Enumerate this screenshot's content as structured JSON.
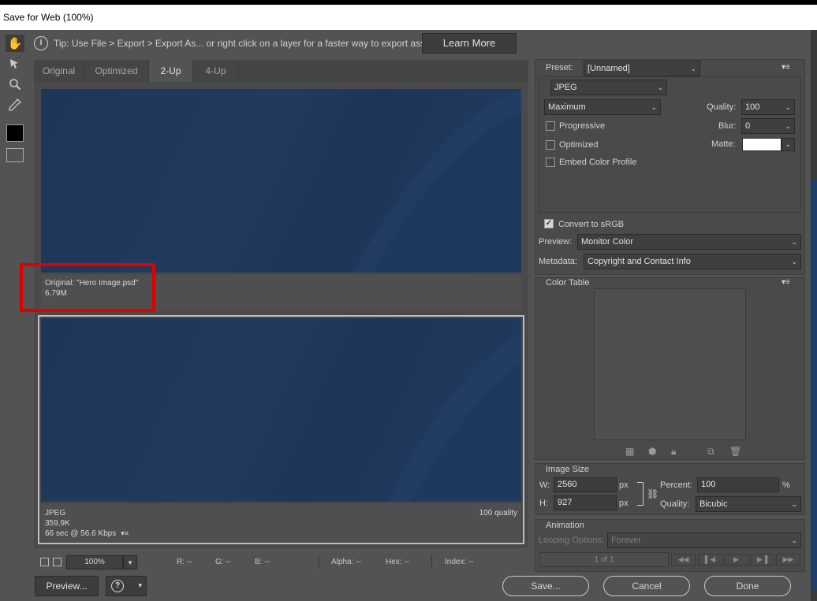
{
  "window": {
    "title": "Save for Web (100%)"
  },
  "tip": {
    "text": "Tip: Use File > Export > Export As...  or right click on a layer for a faster way to export assets",
    "learn_more": "Learn More"
  },
  "tabs": [
    {
      "label": "Original"
    },
    {
      "label": "Optimized"
    },
    {
      "label": "2-Up",
      "active": true
    },
    {
      "label": "4-Up"
    }
  ],
  "original_pane": {
    "name": "Original: \"Hero Image.psd\"",
    "size": "6,79M"
  },
  "optimized_pane": {
    "format": "JPEG",
    "size": "359,9K",
    "time": "66 sec @ 56.6 Kbps",
    "quality": "100 quality"
  },
  "statusbar": {
    "zoom": "100%",
    "r": "R: --",
    "g": "G: --",
    "b": "B: --",
    "alpha": "Alpha: --",
    "hex": "Hex: --",
    "index": "Index: --"
  },
  "buttons": {
    "preview": "Preview...",
    "save": "Save...",
    "cancel": "Cancel",
    "done": "Done"
  },
  "settings": {
    "preset_label": "Preset:",
    "preset_value": "[Unnamed]",
    "format": "JPEG",
    "compression": "Maximum",
    "quality_label": "Quality:",
    "quality_value": "100",
    "blur_label": "Blur:",
    "blur_value": "0",
    "matte_label": "Matte:",
    "progressive": "Progressive",
    "optimized": "Optimized",
    "embed_profile": "Embed Color Profile",
    "convert_srgb": "Convert to sRGB",
    "preview_label": "Preview:",
    "preview_value": "Monitor Color",
    "metadata_label": "Metadata:",
    "metadata_value": "Copyright and Contact Info"
  },
  "color_table": {
    "title": "Color Table"
  },
  "image_size": {
    "title": "Image Size",
    "w_label": "W:",
    "w_value": "2560",
    "h_label": "H:",
    "h_value": "927",
    "unit": "px",
    "percent_label": "Percent:",
    "percent_value": "100",
    "percent_unit": "%",
    "quality_label": "Quality:",
    "quality_value": "Bicubic"
  },
  "animation": {
    "title": "Animation",
    "looping_label": "Looping Options:",
    "looping_value": "Forever",
    "frame": "1 of 1"
  },
  "colors": {
    "image_blue": "#213a5e",
    "highlight": "#e00000",
    "accent_strip": "#1d3f6b"
  }
}
